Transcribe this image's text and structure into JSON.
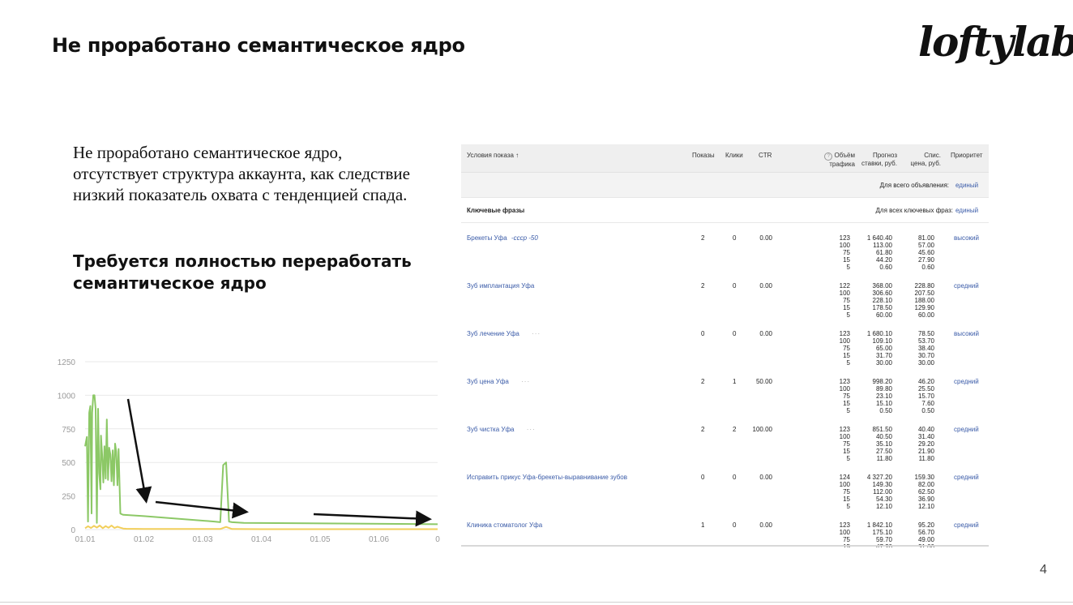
{
  "slide": {
    "title": "Не проработано семантическое ядро",
    "logo": "loftylab",
    "body_text": "Не проработано семантическое ядро, отсутствует структура аккаунта, как следствие низкий показатель охвата с тенденцией спада.",
    "emphasis": "Требуется полностью переработать семантическое ядро",
    "page_number": "4"
  },
  "chart_data": {
    "type": "line",
    "x_ticks": [
      "01.01",
      "01.02",
      "01.03",
      "01.04",
      "01.05",
      "01.06",
      "0"
    ],
    "y_ticks": [
      "0",
      "250",
      "500",
      "750",
      "1000",
      "1250"
    ],
    "ylim": [
      0,
      1250
    ],
    "grid": true,
    "series": [
      {
        "color": "#8cc866",
        "x": [
          0,
          0.03,
          0.05,
          0.07,
          0.09,
          0.11,
          0.12,
          0.14,
          0.16,
          0.18,
          0.2,
          0.22,
          0.24,
          0.26,
          0.27,
          0.29,
          0.31,
          0.33,
          0.35,
          0.37,
          0.39,
          0.41,
          0.43,
          0.45,
          0.47,
          0.49,
          0.51,
          0.53,
          0.55,
          0.57,
          0.6,
          0.62,
          0.65,
          1,
          2.2,
          2.3,
          2.35,
          2.4,
          2.45,
          2.5,
          2.7,
          6.0
        ],
        "y": [
          620,
          690,
          60,
          870,
          920,
          120,
          870,
          1000,
          1000,
          900,
          50,
          900,
          420,
          300,
          700,
          560,
          350,
          620,
          380,
          820,
          370,
          610,
          560,
          360,
          590,
          330,
          640,
          580,
          330,
          600,
          120,
          115,
          110,
          100,
          60,
          55,
          480,
          500,
          60,
          55,
          50,
          40
        ]
      },
      {
        "color": "#f2cf5b",
        "x": [
          0,
          0.05,
          0.1,
          0.15,
          0.2,
          0.25,
          0.3,
          0.35,
          0.4,
          0.45,
          0.5,
          0.55,
          0.6,
          0.65,
          0.7,
          1.0,
          2.3,
          2.4,
          2.5,
          3.0,
          6.0
        ],
        "y": [
          10,
          25,
          12,
          28,
          15,
          30,
          10,
          26,
          14,
          30,
          12,
          22,
          14,
          8,
          6,
          4,
          4,
          20,
          4,
          3,
          3
        ]
      }
    ]
  },
  "table": {
    "headers": {
      "conditions": "Условия показа ↑",
      "impressions": "Показы",
      "clicks": "Клики",
      "ctr": "CTR",
      "traffic_l1": "Объём",
      "traffic_l2": "трафика",
      "forecast_l1": "Прогноз",
      "forecast_l2": "ставки, руб.",
      "charge_l1": "Спис.",
      "charge_l2": "цена, руб.",
      "priority": "Приоритет"
    },
    "ad_row": {
      "label": "Для всего объявления:",
      "value": "единый"
    },
    "group_row": {
      "title": "Ключевые фразы",
      "label": "Для всех ключевых фраз:",
      "value": "единый"
    },
    "rows": [
      {
        "phrase": "Брекеты Уфа",
        "minus": "-ссср -50",
        "dots": "",
        "impressions": "2",
        "clicks": "0",
        "ctr": "0.00",
        "traffic": [
          "123",
          "100",
          "75",
          "15",
          "5"
        ],
        "forecast": [
          "1 640.40",
          "113.00",
          "61.80",
          "44.20",
          "0.60"
        ],
        "charge": [
          "81.00",
          "57.00",
          "45.60",
          "27.90",
          "0.60"
        ],
        "priority": "высокий"
      },
      {
        "phrase": "Зуб имплантация Уфа",
        "minus": "",
        "dots": "",
        "impressions": "2",
        "clicks": "0",
        "ctr": "0.00",
        "traffic": [
          "122",
          "100",
          "75",
          "15",
          "5"
        ],
        "forecast": [
          "368.00",
          "306.60",
          "228.10",
          "178.50",
          "60.00"
        ],
        "charge": [
          "228.80",
          "207.50",
          "188.00",
          "129.90",
          "60.00"
        ],
        "priority": "средний"
      },
      {
        "phrase": "Зуб лечение Уфа",
        "minus": "",
        "dots": "···",
        "impressions": "0",
        "clicks": "0",
        "ctr": "0.00",
        "traffic": [
          "123",
          "100",
          "75",
          "15",
          "5"
        ],
        "forecast": [
          "1 680.10",
          "109.10",
          "65.00",
          "31.70",
          "30.00"
        ],
        "charge": [
          "78.50",
          "53.70",
          "38.40",
          "30.70",
          "30.00"
        ],
        "priority": "высокий"
      },
      {
        "phrase": "Зуб цена Уфа",
        "minus": "",
        "dots": "···",
        "impressions": "2",
        "clicks": "1",
        "ctr": "50.00",
        "traffic": [
          "123",
          "100",
          "75",
          "15",
          "5"
        ],
        "forecast": [
          "998.20",
          "89.80",
          "23.10",
          "15.10",
          "0.50"
        ],
        "charge": [
          "46.20",
          "25.50",
          "15.70",
          "7.60",
          "0.50"
        ],
        "priority": "средний"
      },
      {
        "phrase": "Зуб чистка Уфа",
        "minus": "",
        "dots": "···",
        "impressions": "2",
        "clicks": "2",
        "ctr": "100.00",
        "traffic": [
          "123",
          "100",
          "75",
          "15",
          "5"
        ],
        "forecast": [
          "851.50",
          "40.50",
          "35.10",
          "27.50",
          "11.80"
        ],
        "charge": [
          "40.40",
          "31.40",
          "29.20",
          "21.90",
          "11.80"
        ],
        "priority": "средний"
      },
      {
        "phrase": "Исправить прикус Уфа-брекеты-выравнивание зубов",
        "minus": "",
        "dots": "",
        "impressions": "0",
        "clicks": "0",
        "ctr": "0.00",
        "traffic": [
          "124",
          "100",
          "75",
          "15",
          "5"
        ],
        "forecast": [
          "4 327.20",
          "149.30",
          "112.00",
          "54.30",
          "12.10"
        ],
        "charge": [
          "159.30",
          "82.00",
          "62.50",
          "36.90",
          "12.10"
        ],
        "priority": "средний"
      },
      {
        "phrase": "Клиника стоматолог Уфа",
        "minus": "",
        "dots": "",
        "impressions": "1",
        "clicks": "0",
        "ctr": "0.00",
        "traffic": [
          "123",
          "100",
          "75",
          "15"
        ],
        "forecast": [
          "1 842.10",
          "175.10",
          "59.70",
          "47.20"
        ],
        "charge": [
          "95.20",
          "56.70",
          "49.00",
          "31.00"
        ],
        "priority": "средний"
      }
    ]
  }
}
